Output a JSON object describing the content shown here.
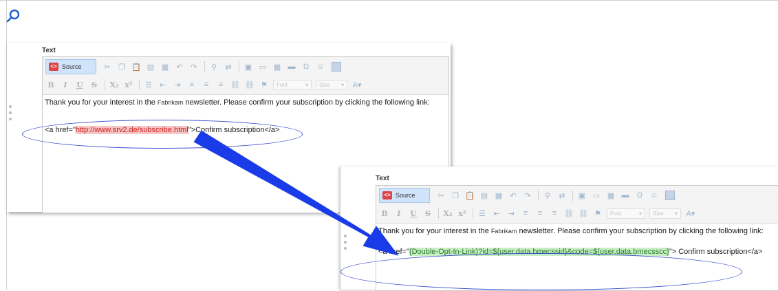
{
  "editors": [
    {
      "label": "Text",
      "toolbar": {
        "source_label": "Source",
        "font_placeholder": "Font",
        "size_placeholder": "Size"
      },
      "content": {
        "text_before_brand": "Thank you for your interest in the ",
        "brand": "Fabrikam",
        "text_after_brand": " newsletter. Please confirm your subscription by clicking the following link:",
        "code_prefix": "<a href=\"",
        "code_url": "http://www.srv2.de/subscribe.html",
        "code_suffix": "\">Confirm subscription</a>"
      }
    },
    {
      "label": "Text",
      "toolbar": {
        "source_label": "Source",
        "font_placeholder": "Font",
        "size_placeholder": "Size"
      },
      "content": {
        "text_before_brand": "Thank you for your interest in the ",
        "brand": "Fabrikam",
        "text_after_brand": " newsletter. Please confirm your subscription by clicking the following link:",
        "code_prefix": "<a href=\"",
        "code_url": "{Double-Opt-In-Link}?id=${user.data.bmecssid}&code=${user.data.bmecsscc}",
        "code_suffix": "\"> Confirm subscription</a>"
      }
    }
  ],
  "icons": {
    "zoom": "magnifier-icon",
    "arrow": "arrow-icon"
  },
  "colors": {
    "annotation_blue": "#1a3be8",
    "highlight_red": "#f6c4c4",
    "highlight_green": "#c8efc4"
  }
}
